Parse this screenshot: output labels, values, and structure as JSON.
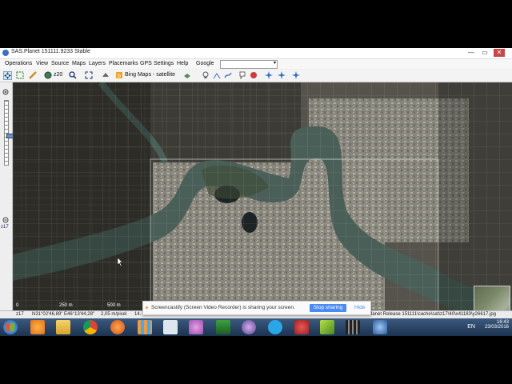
{
  "window": {
    "title": "SAS.Planet 151111.9233 Stable",
    "controls": [
      "—",
      "▭",
      "✕"
    ]
  },
  "menu": {
    "items": [
      "Operations",
      "View",
      "Source",
      "Maps",
      "Layers",
      "Placemarks",
      "GPS",
      "Settings",
      "Help"
    ],
    "search_provider": "Google",
    "search_arrow": "▾"
  },
  "toolbar": {
    "zoom_label": "z20",
    "map_source": "Bing Maps - satellite"
  },
  "left_panel": {
    "zoom_level": "z17",
    "zoom_slider_level": 0.55
  },
  "map": {
    "scale_labels": [
      "0",
      "250 m",
      "500 m"
    ]
  },
  "status": {
    "zoom": "z17",
    "coordinates": "N31°02'46,89\" E46°13'44,28\"",
    "resolution": "2,05 m/pixel",
    "truncated": "14.",
    "release_path": "lanet Release 151111\\cache\\sat\\z17\\40\\x41183\\y26617.jpg"
  },
  "share_bar": {
    "message": "Screencastify (Screen Video Recorder) is sharing your screen.",
    "stop_label": "Stop sharing",
    "hide_label": "Hide"
  },
  "taskbar": {
    "apps": [
      "explorer",
      "media-player",
      "file-manager",
      "chrome",
      "firefox",
      "apps-grid",
      "calculator",
      "paint",
      "screen-capture",
      "browser-alt",
      "skype",
      "bug-tool",
      "editor",
      "video-player",
      "network-app"
    ],
    "lang": "EN",
    "time": "16:43",
    "date": "23/03/2016"
  },
  "colors": {
    "river": "#4a5f58",
    "share_button": "#4a8af4",
    "taskbar": "#2a4567"
  }
}
